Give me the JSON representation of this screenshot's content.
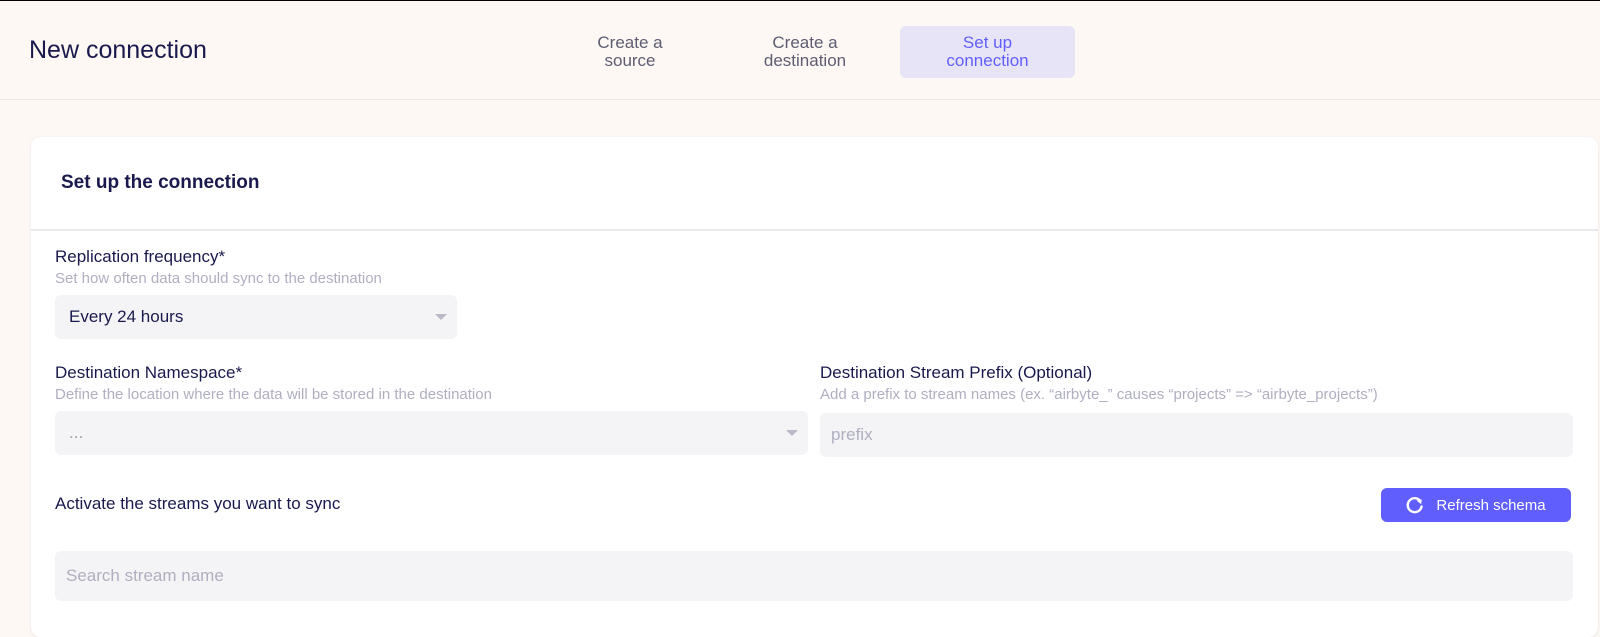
{
  "header": {
    "title": "New connection",
    "steps": [
      {
        "line1": "Create a",
        "line2": "source",
        "active": false
      },
      {
        "line1": "Create a",
        "line2": "destination",
        "active": false
      },
      {
        "line1": "Set up",
        "line2": "connection",
        "active": true
      }
    ]
  },
  "card": {
    "title": "Set up the connection",
    "replication": {
      "label": "Replication frequency*",
      "hint": "Set how often data should sync to the destination",
      "value": "Every 24 hours"
    },
    "namespace": {
      "label": "Destination Namespace*",
      "hint": "Define the location where the data will be stored in the destination",
      "value": "..."
    },
    "prefix": {
      "label": "Destination Stream Prefix (Optional)",
      "hint": "Add a prefix to stream names (ex. “airbyte_” causes “projects” => “airbyte_projects”)",
      "placeholder": "prefix"
    },
    "streams": {
      "label": "Activate the streams you want to sync",
      "refresh_label": "Refresh schema",
      "search_placeholder": "Search stream name"
    }
  },
  "colors": {
    "accent": "#615efe",
    "active_step_bg": "#e8e4f7",
    "page_bg": "#fdf8f4"
  },
  "icons": {
    "refresh": "refresh-icon",
    "dropdown": "chevron-down-icon"
  }
}
